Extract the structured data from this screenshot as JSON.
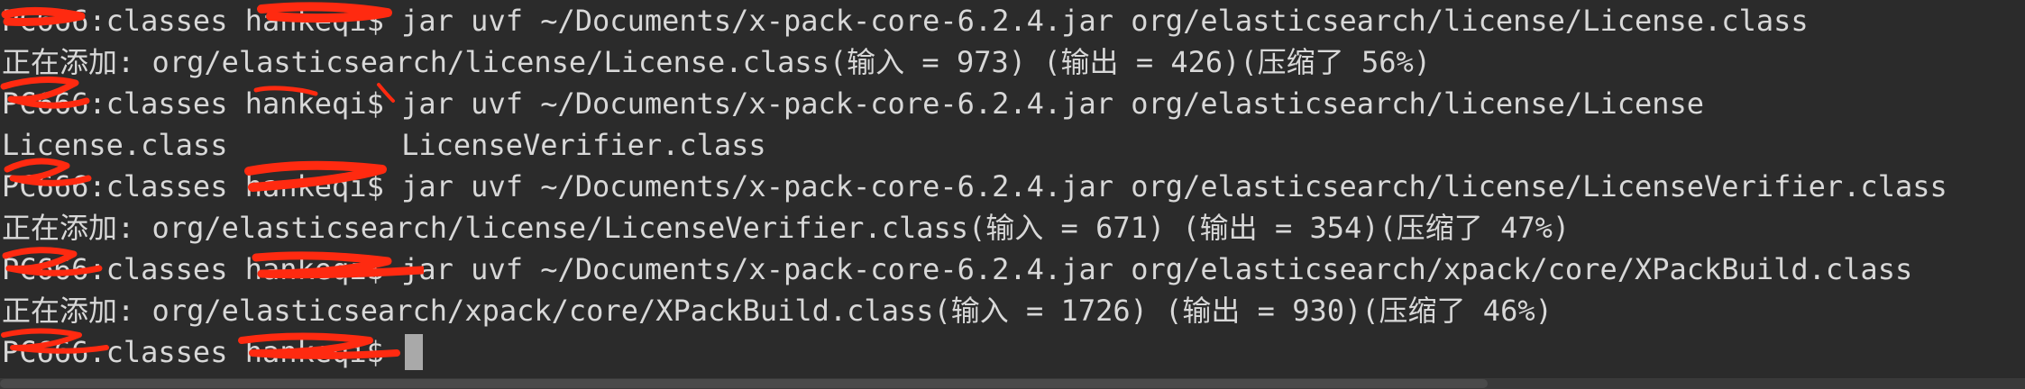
{
  "terminal": {
    "lines": [
      {
        "kind": "command",
        "prompt": "PC666:classes hankeqi$ ",
        "text": "jar uvf ~/Documents/x-pack-core-6.2.4.jar org/elasticsearch/license/License.class"
      },
      {
        "kind": "output",
        "text": "正在添加: org/elasticsearch/license/License.class(输入 = 973) (输出 = 426)(压缩了 56%)"
      },
      {
        "kind": "command",
        "prompt": "PC666:classes hankeqi$ ",
        "text": "jar uvf ~/Documents/x-pack-core-6.2.4.jar org/elasticsearch/license/License"
      },
      {
        "kind": "output",
        "text": "License.class          LicenseVerifier.class"
      },
      {
        "kind": "command",
        "prompt": "PC666:classes hankeqi$ ",
        "text": "jar uvf ~/Documents/x-pack-core-6.2.4.jar org/elasticsearch/license/LicenseVerifier.class"
      },
      {
        "kind": "output",
        "text": "正在添加: org/elasticsearch/license/LicenseVerifier.class(输入 = 671) (输出 = 354)(压缩了 47%)"
      },
      {
        "kind": "command",
        "prompt": "PC666:classes hankeqi$ ",
        "text": "jar uvf ~/Documents/x-pack-core-6.2.4.jar org/elasticsearch/xpack/core/XPackBuild.class"
      },
      {
        "kind": "output",
        "text": "正在添加: org/elasticsearch/xpack/core/XPackBuild.class(输入 = 1726) (输出 = 930)(压缩了 46%)"
      },
      {
        "kind": "command",
        "prompt": "PC666:classes hankeqi$ ",
        "text": ""
      }
    ]
  },
  "colors": {
    "background": "#2b2b2b",
    "text": "#d8d8d8",
    "redaction": "#ff2a10",
    "cursor": "#a9a9a9"
  }
}
